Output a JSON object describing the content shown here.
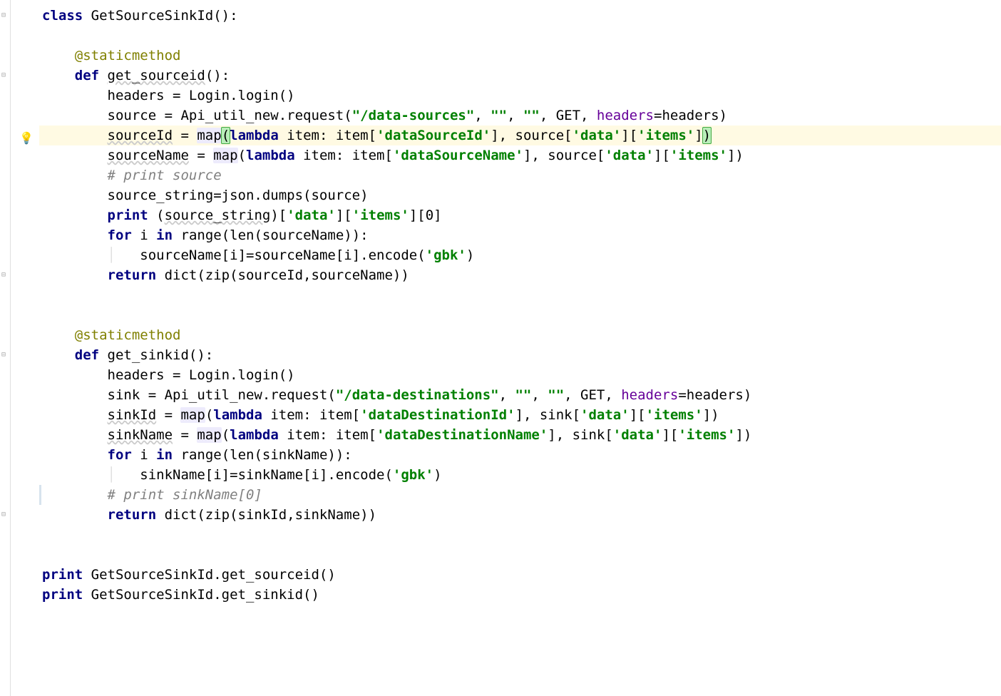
{
  "lines": [
    {
      "indent": 0,
      "tokens": [
        {
          "cls": "kw",
          "t": "class "
        },
        {
          "cls": "txt",
          "t": "GetSourceSinkId():"
        }
      ],
      "fold": true
    },
    {
      "indent": 0,
      "tokens": []
    },
    {
      "indent": 1,
      "tokens": [
        {
          "cls": "dec",
          "t": "@staticmethod"
        }
      ]
    },
    {
      "indent": 1,
      "tokens": [
        {
          "cls": "kw",
          "t": "def "
        },
        {
          "cls": "txt warn",
          "t": "get_sourceid"
        },
        {
          "cls": "txt",
          "t": "():"
        }
      ],
      "fold": true
    },
    {
      "indent": 2,
      "tokens": [
        {
          "cls": "txt",
          "t": "headers = Login.login()"
        }
      ]
    },
    {
      "indent": 2,
      "tokens": [
        {
          "cls": "txt",
          "t": "source = Api_util_new.request("
        },
        {
          "cls": "str",
          "t": "\"/data-sources\""
        },
        {
          "cls": "txt",
          "t": ", "
        },
        {
          "cls": "str",
          "t": "\"\""
        },
        {
          "cls": "txt",
          "t": ", "
        },
        {
          "cls": "str",
          "t": "\"\""
        },
        {
          "cls": "txt",
          "t": ", GET, "
        },
        {
          "cls": "arg",
          "t": "headers"
        },
        {
          "cls": "txt",
          "t": "=headers)"
        }
      ]
    },
    {
      "indent": 2,
      "hl": true,
      "bulb": true,
      "tokens": [
        {
          "cls": "txt warn",
          "t": "sourceId"
        },
        {
          "cls": "txt",
          "t": " = "
        },
        {
          "cls": "txt occur",
          "t": "map"
        },
        {
          "cls": "txt matchparen",
          "t": "("
        },
        {
          "cls": "kw",
          "t": "lambda"
        },
        {
          "cls": "txt",
          "t": " item: item["
        },
        {
          "cls": "str",
          "t": "'dataSourceId'"
        },
        {
          "cls": "txt",
          "t": "], source["
        },
        {
          "cls": "str",
          "t": "'data'"
        },
        {
          "cls": "txt",
          "t": "]["
        },
        {
          "cls": "str",
          "t": "'items'"
        },
        {
          "cls": "txt",
          "t": "]"
        },
        {
          "cls": "txt matchparen",
          "t": ")"
        }
      ],
      "caret": true
    },
    {
      "indent": 2,
      "tokens": [
        {
          "cls": "txt warn",
          "t": "sourceName"
        },
        {
          "cls": "txt",
          "t": " = "
        },
        {
          "cls": "txt occur",
          "t": "map"
        },
        {
          "cls": "txt",
          "t": "("
        },
        {
          "cls": "kw",
          "t": "lambda"
        },
        {
          "cls": "txt",
          "t": " item: item["
        },
        {
          "cls": "str",
          "t": "'dataSourceName'"
        },
        {
          "cls": "txt",
          "t": "], source["
        },
        {
          "cls": "str",
          "t": "'data'"
        },
        {
          "cls": "txt",
          "t": "]["
        },
        {
          "cls": "str",
          "t": "'items'"
        },
        {
          "cls": "txt",
          "t": "])"
        }
      ]
    },
    {
      "indent": 2,
      "tokens": [
        {
          "cls": "cmt",
          "t": "# print source"
        }
      ]
    },
    {
      "indent": 2,
      "tokens": [
        {
          "cls": "txt",
          "t": "source_string=json.dumps(source)"
        }
      ]
    },
    {
      "indent": 2,
      "tokens": [
        {
          "cls": "kw",
          "t": "print "
        },
        {
          "cls": "txt",
          "t": "("
        },
        {
          "cls": "txt warn",
          "t": "source_string"
        },
        {
          "cls": "txt",
          "t": ")["
        },
        {
          "cls": "str",
          "t": "'data'"
        },
        {
          "cls": "txt",
          "t": "]["
        },
        {
          "cls": "str",
          "t": "'items'"
        },
        {
          "cls": "txt",
          "t": "][0]"
        }
      ]
    },
    {
      "indent": 2,
      "tokens": [
        {
          "cls": "kw",
          "t": "for "
        },
        {
          "cls": "txt",
          "t": "i "
        },
        {
          "cls": "kw",
          "t": "in "
        },
        {
          "cls": "txt",
          "t": "range(len(sourceName)):"
        }
      ]
    },
    {
      "indent": 3,
      "tokens": [
        {
          "cls": "txt",
          "t": "sourceName[i]=sourceName[i].encode("
        },
        {
          "cls": "str",
          "t": "'gbk'"
        },
        {
          "cls": "txt",
          "t": ")"
        }
      ]
    },
    {
      "indent": 2,
      "tokens": [
        {
          "cls": "kw",
          "t": "return "
        },
        {
          "cls": "txt",
          "t": "dict(zip(sourceId,sourceName))"
        }
      ],
      "fold": true
    },
    {
      "indent": 0,
      "tokens": []
    },
    {
      "indent": 0,
      "tokens": []
    },
    {
      "indent": 1,
      "tokens": [
        {
          "cls": "dec",
          "t": "@staticmethod"
        }
      ]
    },
    {
      "indent": 1,
      "tokens": [
        {
          "cls": "kw",
          "t": "def "
        },
        {
          "cls": "txt",
          "t": "get_sinkid():"
        }
      ],
      "fold": true
    },
    {
      "indent": 2,
      "tokens": [
        {
          "cls": "txt",
          "t": "headers = Login.login()"
        }
      ]
    },
    {
      "indent": 2,
      "tokens": [
        {
          "cls": "txt",
          "t": "sink = Api_util_new.request("
        },
        {
          "cls": "str",
          "t": "\"/data-destinations\""
        },
        {
          "cls": "txt",
          "t": ", "
        },
        {
          "cls": "str",
          "t": "\"\""
        },
        {
          "cls": "txt",
          "t": ", "
        },
        {
          "cls": "str",
          "t": "\"\""
        },
        {
          "cls": "txt",
          "t": ", GET, "
        },
        {
          "cls": "arg",
          "t": "headers"
        },
        {
          "cls": "txt",
          "t": "=headers)"
        }
      ]
    },
    {
      "indent": 2,
      "tokens": [
        {
          "cls": "txt warn",
          "t": "sinkId"
        },
        {
          "cls": "txt",
          "t": " = "
        },
        {
          "cls": "txt occur",
          "t": "map"
        },
        {
          "cls": "txt",
          "t": "("
        },
        {
          "cls": "kw",
          "t": "lambda"
        },
        {
          "cls": "txt",
          "t": " item: item["
        },
        {
          "cls": "str",
          "t": "'dataDestinationId'"
        },
        {
          "cls": "txt",
          "t": "], sink["
        },
        {
          "cls": "str",
          "t": "'data'"
        },
        {
          "cls": "txt",
          "t": "]["
        },
        {
          "cls": "str",
          "t": "'items'"
        },
        {
          "cls": "txt",
          "t": "])"
        }
      ]
    },
    {
      "indent": 2,
      "tokens": [
        {
          "cls": "txt warn",
          "t": "sinkName"
        },
        {
          "cls": "txt",
          "t": " = "
        },
        {
          "cls": "txt occur",
          "t": "map"
        },
        {
          "cls": "txt",
          "t": "("
        },
        {
          "cls": "kw",
          "t": "lambda"
        },
        {
          "cls": "txt",
          "t": " item: item["
        },
        {
          "cls": "str",
          "t": "'dataDestinationName'"
        },
        {
          "cls": "txt",
          "t": "], sink["
        },
        {
          "cls": "str",
          "t": "'data'"
        },
        {
          "cls": "txt",
          "t": "]["
        },
        {
          "cls": "str",
          "t": "'items'"
        },
        {
          "cls": "txt",
          "t": "])"
        }
      ]
    },
    {
      "indent": 2,
      "tokens": [
        {
          "cls": "kw",
          "t": "for "
        },
        {
          "cls": "txt",
          "t": "i "
        },
        {
          "cls": "kw",
          "t": "in "
        },
        {
          "cls": "txt",
          "t": "range(len(sinkName)):"
        }
      ]
    },
    {
      "indent": 3,
      "tokens": [
        {
          "cls": "txt",
          "t": "sinkName[i]=sinkName[i].encode("
        },
        {
          "cls": "str",
          "t": "'gbk'"
        },
        {
          "cls": "txt",
          "t": ")"
        }
      ]
    },
    {
      "indent": 2,
      "tokens": [
        {
          "cls": "cmt",
          "t": "# print sinkName[0]"
        }
      ],
      "caretMarker": true
    },
    {
      "indent": 2,
      "tokens": [
        {
          "cls": "kw",
          "t": "return "
        },
        {
          "cls": "txt",
          "t": "dict(zip(sinkId,sinkName))"
        }
      ],
      "fold": true
    },
    {
      "indent": 0,
      "tokens": []
    },
    {
      "indent": 0,
      "tokens": []
    },
    {
      "indent": 0,
      "tokens": [
        {
          "cls": "kw",
          "t": "print "
        },
        {
          "cls": "txt",
          "t": "GetSourceSinkId.get_sourceid()"
        }
      ]
    },
    {
      "indent": 0,
      "tokens": [
        {
          "cls": "kw",
          "t": "print "
        },
        {
          "cls": "txt",
          "t": "GetSourceSinkId.get_sinkid()"
        }
      ]
    }
  ],
  "indentGuide": "│",
  "lineHeight": 28
}
